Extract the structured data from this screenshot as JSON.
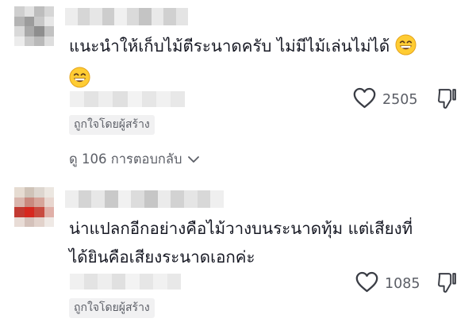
{
  "comments": [
    {
      "text_line1": "แนะนำให้เก็บไม้ตีระนาดครับ ไม่มีไม้เล่นไม่ได้",
      "likes": "2505",
      "badge": "ถูกใจโดยผู้สร้าง",
      "replies_label": "ดู 106 การตอบกลับ",
      "emoji": "grinning-face-with-smiling-eyes"
    },
    {
      "text_line1": "น่าแปลกอีกอย่างคือไม้วางบนระนาดทุ้ม แต่เสียงที่",
      "text_line2": "ได้ยินคือเสียงระนาดเอกค่ะ",
      "likes": "1085",
      "badge": "ถูกใจโดยผู้สร้าง"
    }
  ],
  "icons": {
    "like": "heart-outline-icon",
    "dislike": "thumbs-down-outline-icon",
    "expand": "chevron-down-icon"
  },
  "colors": {
    "text": "#161823",
    "secondary": "#5b5e66",
    "badge_bg": "#f1f1f2"
  }
}
